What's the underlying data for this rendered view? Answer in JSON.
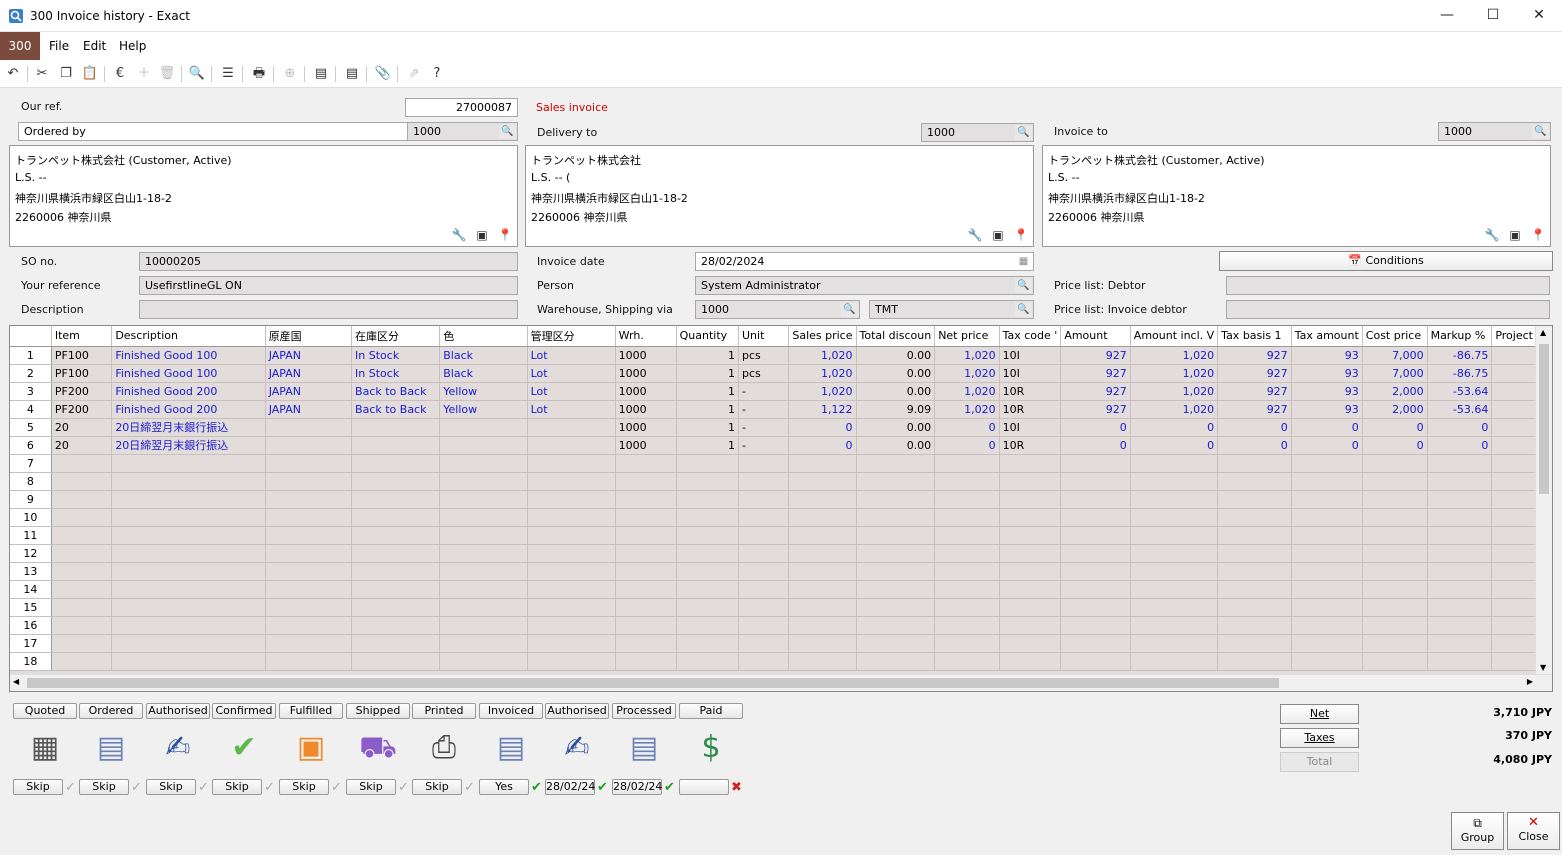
{
  "window": {
    "title": "300 Invoice history - Exact",
    "minimize": "—",
    "maximize": "☐",
    "close": "✕"
  },
  "menu": {
    "module": "300",
    "file": "File",
    "edit": "Edit",
    "help": "Help"
  },
  "header": {
    "our_ref_label": "Our ref.",
    "our_ref": "27000087",
    "doc_type": "Sales invoice",
    "ordered_by_label": "Ordered by",
    "ordered_by": "1000",
    "delivery_to_label": "Delivery to",
    "delivery_to": "1000",
    "invoice_to_label": "Invoice to",
    "invoice_to": "1000"
  },
  "addresses": [
    {
      "l1": "トランペット株式会社 (Customer, Active)",
      "l2": "L.S. --",
      "l3": "神奈川県横浜市緑区白山1-18-2",
      "l4": "2260006  神奈川県"
    },
    {
      "l1": "トランペット株式会社",
      "l2": "L.S. -- (",
      "l3": "神奈川県横浜市緑区白山1-18-2",
      "l4": "2260006  神奈川県"
    },
    {
      "l1": "トランペット株式会社 (Customer, Active)",
      "l2": "L.S. --",
      "l3": "神奈川県横浜市緑区白山1-18-2",
      "l4": "2260006  神奈川県"
    }
  ],
  "details": {
    "so_no_label": "SO no.",
    "so_no": "10000205",
    "your_ref_label": "Your reference",
    "your_ref": "UsefirstlineGL ON",
    "description_label": "Description",
    "description": "",
    "invoice_date_label": "Invoice date",
    "invoice_date": "28/02/2024",
    "person_label": "Person",
    "person": "System Administrator",
    "warehouse_label": "Warehouse, Shipping via",
    "warehouse": "1000",
    "shipping_via": "TMT",
    "conditions_label": "Conditions",
    "price_list_debtor_label": "Price list: Debtor",
    "price_list_invoice_label": "Price list: Invoice debtor"
  },
  "grid": {
    "columns": [
      "Item",
      "Description",
      "原産国",
      "在庫区分",
      "色",
      "管理区分",
      "Wrh.",
      "Quantity",
      "Unit",
      "Sales price",
      "Total discoun",
      "Net price",
      "Tax code '",
      "Amount",
      "Amount incl. V",
      "Tax basis 1",
      "Tax amount",
      "Cost price",
      "Markup %",
      "Project c"
    ],
    "rows": [
      [
        "PF100",
        "Finished Good 100",
        "JAPAN",
        "In Stock",
        "Black",
        "Lot",
        "1000",
        "1",
        "pcs",
        "1,020",
        "0.00",
        "1,020",
        "10I",
        "927",
        "1,020",
        "927",
        "93",
        "7,000",
        "-86.75",
        ""
      ],
      [
        "PF100",
        "Finished Good 100",
        "JAPAN",
        "In Stock",
        "Black",
        "Lot",
        "1000",
        "1",
        "pcs",
        "1,020",
        "0.00",
        "1,020",
        "10I",
        "927",
        "1,020",
        "927",
        "93",
        "7,000",
        "-86.75",
        ""
      ],
      [
        "PF200",
        "Finished Good 200",
        "JAPAN",
        "Back to Back",
        "Yellow",
        "Lot",
        "1000",
        "1",
        "-",
        "1,020",
        "0.00",
        "1,020",
        "10R",
        "927",
        "1,020",
        "927",
        "93",
        "2,000",
        "-53.64",
        ""
      ],
      [
        "PF200",
        "Finished Good 200",
        "JAPAN",
        "Back to Back",
        "Yellow",
        "Lot",
        "1000",
        "1",
        "-",
        "1,122",
        "9.09",
        "1,020",
        "10R",
        "927",
        "1,020",
        "927",
        "93",
        "2,000",
        "-53.64",
        ""
      ],
      [
        "20",
        "20日締翌月末銀行振込",
        "",
        "",
        "",
        "",
        "1000",
        "1",
        "-",
        "0",
        "0.00",
        "0",
        "10I",
        "0",
        "0",
        "0",
        "0",
        "0",
        "0",
        ""
      ],
      [
        "20",
        "20日締翌月末銀行振込",
        "",
        "",
        "",
        "",
        "1000",
        "1",
        "-",
        "0",
        "0.00",
        "0",
        "10R",
        "0",
        "0",
        "0",
        "0",
        "0",
        "0",
        ""
      ]
    ],
    "row_numbers": [
      "1",
      "2",
      "3",
      "4",
      "5",
      "6",
      "7",
      "8",
      "9",
      "10",
      "11",
      "12",
      "13",
      "14",
      "15",
      "16",
      "17",
      "18"
    ]
  },
  "status": {
    "stages": [
      "Quoted",
      "Ordered",
      "Authorised",
      "Confirmed",
      "Fulfilled",
      "Shipped",
      "Printed",
      "Invoiced",
      "Authorised",
      "Processed",
      "Paid"
    ],
    "icons": [
      "calculator-icon",
      "document-icon",
      "signature-icon",
      "approved-badge-icon",
      "delivery-box-icon",
      "truck-icon",
      "printer-icon",
      "invoice-paid-icon",
      "signature-approved-icon",
      "processed-document-icon",
      "money-icon"
    ],
    "actions": [
      "Skip",
      "Skip",
      "Skip",
      "Skip",
      "Skip",
      "Skip",
      "Skip",
      "Yes",
      "28/02/24",
      "28/02/24",
      ""
    ]
  },
  "totals": {
    "net_label": "Net",
    "net": "3,710 JPY",
    "taxes_label": "Taxes",
    "taxes": "370 JPY",
    "total_label": "Total",
    "total": "4,080 JPY"
  },
  "footer": {
    "group_label": "Group",
    "close_label": "Close"
  }
}
